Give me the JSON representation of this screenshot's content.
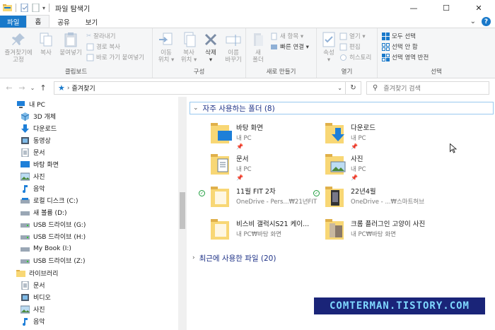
{
  "window": {
    "title": "파일 탐색기",
    "minimize": "—",
    "maximize": "☐",
    "close": "✕"
  },
  "tabs": {
    "file": "파일",
    "home": "홈",
    "share": "공유",
    "view": "보기",
    "collapse": "⌄",
    "help": "?"
  },
  "ribbon": {
    "clipboard": {
      "label": "클립보드",
      "pin": "즐겨찾기에\n고정",
      "copy": "복사",
      "paste": "붙여넣기",
      "cut": "잘라내기",
      "copy_path": "경로 복사",
      "paste_shortcut": "바로 가기 붙여넣기"
    },
    "organize": {
      "label": "구성",
      "move_to": "이동\n위치 ▾",
      "copy_to": "복사\n위치 ▾",
      "delete": "삭제\n▾",
      "rename": "이름\n바꾸기"
    },
    "new": {
      "label": "새로 만들기",
      "new_folder": "새\n폴더",
      "new_item": "새 항목 ▾",
      "easy_access": "빠른 연결 ▾"
    },
    "open": {
      "label": "열기",
      "properties": "속성\n▾",
      "open": "열기 ▾",
      "edit": "편집",
      "history": "히스토리"
    },
    "select": {
      "label": "선택",
      "select_all": "모두 선택",
      "select_none": "선택 안 함",
      "invert": "선택 영역 반전"
    }
  },
  "navbar": {
    "back": "←",
    "forward": "→",
    "recent": "⌄",
    "up": "↑",
    "breadcrumb_sep": "›",
    "location": "즐겨찾기",
    "dropdown": "⌄",
    "refresh": "↻",
    "search_placeholder": "즐겨찾기 검색"
  },
  "sidebar": {
    "items": [
      {
        "label": "내 PC",
        "icon": "pc-icon"
      },
      {
        "label": "3D 개체",
        "icon": "cube-icon"
      },
      {
        "label": "다운로드",
        "icon": "download-icon"
      },
      {
        "label": "동영상",
        "icon": "video-icon"
      },
      {
        "label": "문서",
        "icon": "document-icon"
      },
      {
        "label": "바탕 화면",
        "icon": "desktop-icon"
      },
      {
        "label": "사진",
        "icon": "picture-icon"
      },
      {
        "label": "음악",
        "icon": "music-icon"
      },
      {
        "label": "로컬 디스크 (C:)",
        "icon": "drive-icon"
      },
      {
        "label": "새 볼륨 (D:)",
        "icon": "drive-icon"
      },
      {
        "label": "USB 드라이브 (G:)",
        "icon": "usb-icon"
      },
      {
        "label": "USB 드라이브 (H:)",
        "icon": "usb-icon"
      },
      {
        "label": "My Book (I:)",
        "icon": "drive-icon"
      },
      {
        "label": "USB 드라이브 (Z:)",
        "icon": "usb-icon"
      },
      {
        "label": "라이브러리",
        "icon": "library-icon"
      },
      {
        "label": "문서",
        "icon": "document-icon"
      },
      {
        "label": "비디오",
        "icon": "video-icon"
      },
      {
        "label": "사진",
        "icon": "picture-icon"
      },
      {
        "label": "음악",
        "icon": "music-icon"
      }
    ]
  },
  "content": {
    "frequent_header": "자주 사용하는 폴더 (8)",
    "recent_header": "최근에 사용한 파일 (20)",
    "folders": [
      {
        "name": "바탕 화면",
        "sub": "내 PC",
        "pin": "📌"
      },
      {
        "name": "다운로드",
        "sub": "내 PC",
        "pin": "📌"
      },
      {
        "name": "문서",
        "sub": "내 PC",
        "pin": "📌"
      },
      {
        "name": "사진",
        "sub": "내 PC",
        "pin": "📌"
      },
      {
        "name": "11월 FIT 2차",
        "sub": "OneDrive - Pers...₩21년FIT",
        "pin": ""
      },
      {
        "name": "22년4월",
        "sub": "OneDrive - ...₩스마트허브",
        "pin": ""
      },
      {
        "name": "비스비 갤럭시S21 케이...",
        "sub": "내 PC₩바탕 화면",
        "pin": ""
      },
      {
        "name": "크롬 플러그인 고양이 사진",
        "sub": "내 PC₩바탕 화면",
        "pin": ""
      }
    ]
  },
  "watermark": "COMTERMAN.TISTORY.COM",
  "colors": {
    "accent": "#1979ca",
    "section_header": "#1e3287",
    "folder_yellow": "#f8d775",
    "folder_dark": "#e0b04a",
    "watermark_bg": "#1a2478",
    "watermark_text": "#7fd8ff"
  }
}
